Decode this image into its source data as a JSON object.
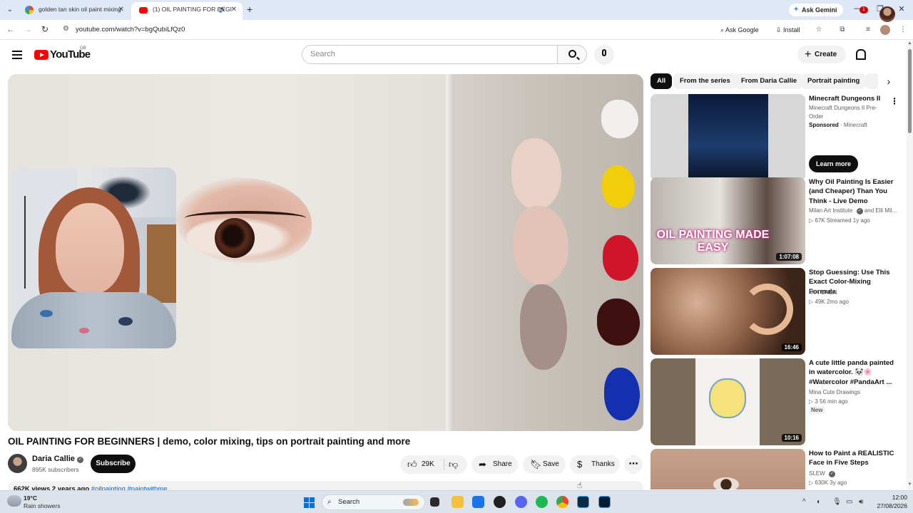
{
  "browser": {
    "tabs": [
      {
        "title": "golden tan skin oil paint mixing",
        "active": false
      },
      {
        "title": "(1) OIL PAINTING FOR BEGI",
        "active": true
      }
    ],
    "ask_gemini": "Ask Gemini",
    "url": "youtube.com/watch?v=bgQubiLfQz0",
    "ask_google": "Ask Google",
    "install": "Install"
  },
  "youtube": {
    "logo_text": "YouTube",
    "region": "GB",
    "search_placeholder": "Search",
    "create_label": "Create",
    "notification_count": "1"
  },
  "video": {
    "title": "OIL PAINTING FOR BEGINNERS | demo, color mixing, tips on portrait painting and more",
    "channel": "Daria Callie",
    "subscribers": "895K subscribers",
    "subscribe_label": "Subscribe",
    "likes": "29K",
    "share_label": "Share",
    "save_label": "Save",
    "thanks_label": "Thanks",
    "views_line": "662K views  2 years ago",
    "tags": "#oilpainting #paintwithme"
  },
  "chips": [
    "All",
    "From the series",
    "From Daria Callie",
    "Portrait painting"
  ],
  "related": [
    {
      "title": "Minecraft Dungeons II",
      "line1": "Minecraft Dungeons II Pre-",
      "line2": "Order",
      "sponsored": "Sponsored",
      "sponsor": "Minecraft",
      "cta": "Learn more"
    },
    {
      "title": "Why Oil Painting Is Easier (and Cheaper) Than You Think - Live Demo",
      "channel": "Milan Art Institute",
      "channel_suffix": "and Elli Mil...",
      "stats": "67K  Streamed 1y ago",
      "duration": "1:07:08",
      "thumb_text": "OIL PAINTING MADE EASY"
    },
    {
      "title": "Stop Guessing: Use This Exact Color-Mixing Formula",
      "channel": "MIN CHEN",
      "stats": "49K  2mo ago",
      "duration": "16:46"
    },
    {
      "title": " A cute little panda painted in watercolor. 🐼🌸 #Watercolor #PandaArt ...",
      "channel": "Mina Cute Drawings",
      "stats": "3  56 min ago",
      "badge": "New",
      "duration": "10:16"
    },
    {
      "title": "How to Paint a REALISTIC Face in Five Steps",
      "channel": "SLEW",
      "stats": "630K  3y ago"
    }
  ],
  "taskbar": {
    "temperature": "19°C",
    "weather": "Rain showers",
    "search_label": "Search",
    "time": "12:00",
    "date": "27/08/2026"
  }
}
